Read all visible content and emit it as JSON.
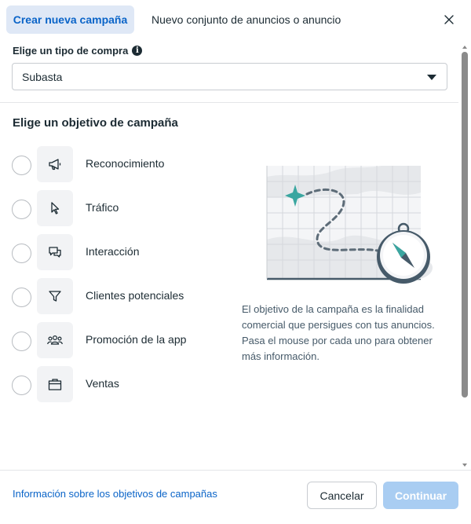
{
  "header": {
    "tab_active": "Crear nueva campaña",
    "tab_other": "Nuevo conjunto de anuncios o anuncio"
  },
  "purchase": {
    "label": "Elige un tipo de compra",
    "selected": "Subasta"
  },
  "objective": {
    "title": "Elige un objetivo de campaña",
    "options": [
      {
        "label": "Reconocimiento",
        "icon": "megaphone-icon"
      },
      {
        "label": "Tráfico",
        "icon": "cursor-icon"
      },
      {
        "label": "Interacción",
        "icon": "chat-bubble-icon"
      },
      {
        "label": "Clientes potenciales",
        "icon": "filter-icon"
      },
      {
        "label": "Promoción de la app",
        "icon": "people-icon"
      },
      {
        "label": "Ventas",
        "icon": "shopping-bag-icon"
      }
    ],
    "description": "El objetivo de la campaña es la finalidad comercial que persigues con tus anuncios. Pasa el mouse por cada uno para obtener más información."
  },
  "footer": {
    "link": "Información sobre los objetivos de campañas",
    "cancel": "Cancelar",
    "continue": "Continuar"
  },
  "colors": {
    "accent": "#0a64c8",
    "accent_light": "#dfe8f6",
    "disabled_button": "#a9cdf2",
    "map_marker": "#3aa6a0"
  }
}
